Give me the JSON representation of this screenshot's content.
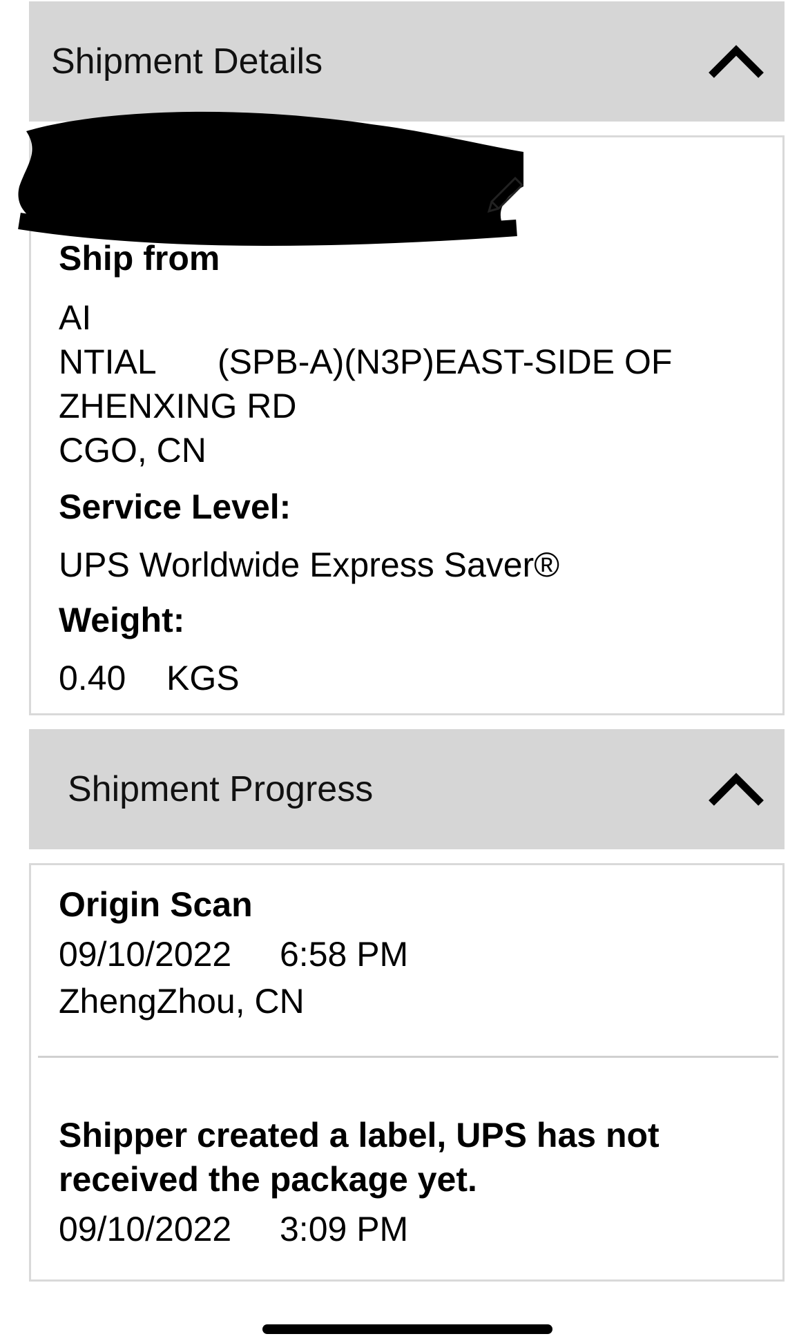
{
  "details": {
    "header": "Shipment Details",
    "ship_from_label": "Ship from",
    "address_line1": "AI",
    "address_line2a": "NTIAL",
    "address_line2b": "(SPB-A)(N3P)EAST-SIDE OF",
    "address_line3": "ZHENXING RD",
    "address_line4": "CGO, CN",
    "service_label": "Service Level:",
    "service_value": "UPS Worldwide Express Saver®",
    "weight_label": "Weight:",
    "weight_value": "0.40",
    "weight_unit": "KGS"
  },
  "progress": {
    "header": "Shipment Progress",
    "events": [
      {
        "title": "Origin Scan",
        "date": "09/10/2022",
        "time": "6:58 PM",
        "location": "ZhengZhou, CN"
      },
      {
        "title_line1": "Shipper created a label, UPS has not",
        "title_line2": "received the package yet.",
        "date": "09/10/2022",
        "time": "3:09 PM"
      }
    ]
  }
}
